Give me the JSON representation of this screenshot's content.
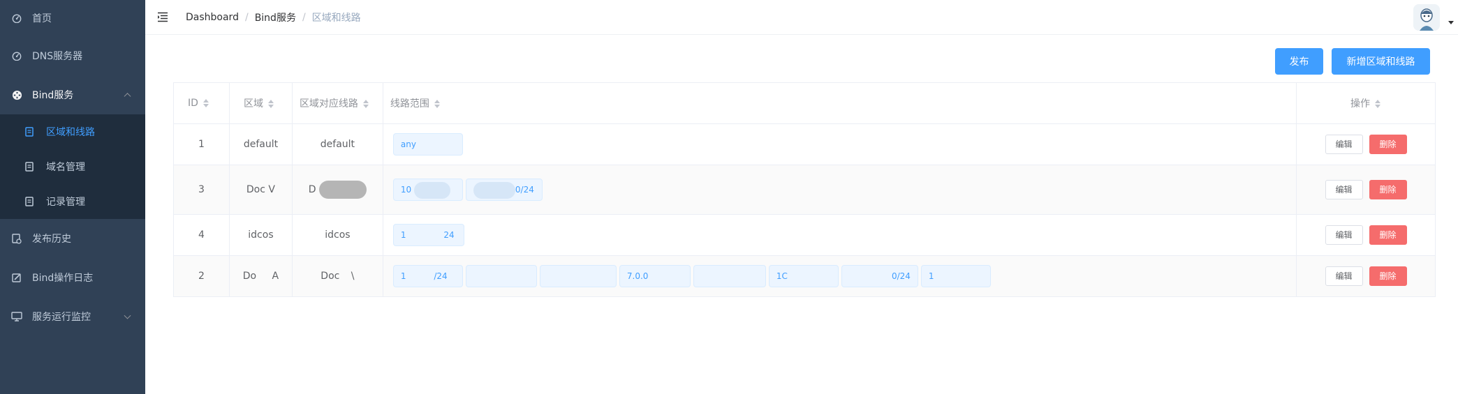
{
  "sidebar": {
    "items": [
      {
        "label": "首页",
        "icon": "dashboard-icon"
      },
      {
        "label": "DNS服务器",
        "icon": "dashboard-icon"
      },
      {
        "label": "Bind服务",
        "icon": "service-icon",
        "expanded": true
      },
      {
        "label": "发布历史",
        "icon": "history-icon"
      },
      {
        "label": "Bind操作日志",
        "icon": "log-icon"
      },
      {
        "label": "服务运行监控",
        "icon": "monitor-icon",
        "expanded": false
      }
    ],
    "submenu": [
      {
        "label": "区域和线路",
        "active": true
      },
      {
        "label": "域名管理"
      },
      {
        "label": "记录管理"
      }
    ]
  },
  "navbar": {
    "breadcrumb": [
      "Dashboard",
      "Bind服务",
      "区域和线路"
    ]
  },
  "toolbar": {
    "publish_label": "发布",
    "add_label": "新增区域和线路"
  },
  "table": {
    "headers": [
      "ID",
      "区域",
      "区域对应线路",
      "线路范围",
      "操作"
    ],
    "edit_label": "编辑",
    "delete_label": "删除",
    "rows": [
      {
        "id": "1",
        "zone": "default",
        "line": "default",
        "ranges": [
          "any"
        ]
      },
      {
        "id": "3",
        "zone": "Doc V",
        "line": "D",
        "ranges": [
          "10",
          "0/24"
        ]
      },
      {
        "id": "4",
        "zone": "idcos",
        "line": "idcos",
        "ranges": [
          "1 24"
        ]
      },
      {
        "id": "2",
        "zone": "Do A",
        "line": "Doc \\",
        "ranges": [
          "1 /24",
          "",
          "",
          "7.0.0",
          "",
          "1C",
          "0/24",
          "1"
        ]
      }
    ]
  },
  "colors": {
    "sidebar_bg": "#304156",
    "submenu_bg": "#1f2d3d",
    "primary": "#409eff",
    "danger": "#f56c6c"
  }
}
